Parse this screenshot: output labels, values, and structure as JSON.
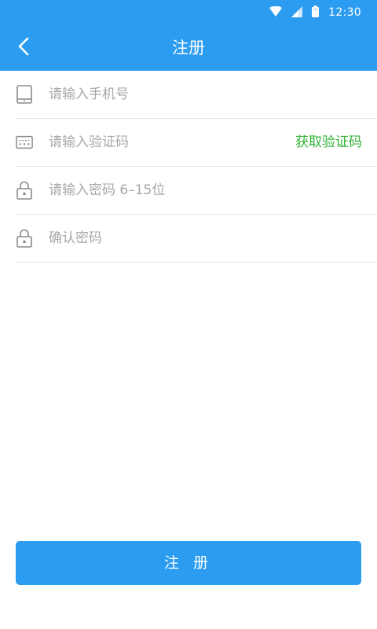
{
  "status_bar": {
    "time": "12:30",
    "icons": [
      "wifi-icon",
      "cell-signal-icon",
      "battery-icon"
    ]
  },
  "app_bar": {
    "title": "注册",
    "back_icon": "chevron-left-icon"
  },
  "form": {
    "phone": {
      "placeholder": "请输入手机号",
      "value": "",
      "icon": "phone-icon"
    },
    "code": {
      "placeholder": "请输入验证码",
      "value": "",
      "icon": "keyboard-icon",
      "action_label": "获取验证码"
    },
    "password": {
      "placeholder": "请输入密码 6–15位",
      "value": "",
      "icon": "lock-icon"
    },
    "confirm_password": {
      "placeholder": "确认密码",
      "value": "",
      "icon": "lock-icon"
    }
  },
  "submit": {
    "label": "注 册"
  },
  "colors": {
    "primary": "#2b9cf0",
    "action_green": "#33b236",
    "placeholder": "#a8a8a8",
    "divider": "#e3e3e3"
  }
}
